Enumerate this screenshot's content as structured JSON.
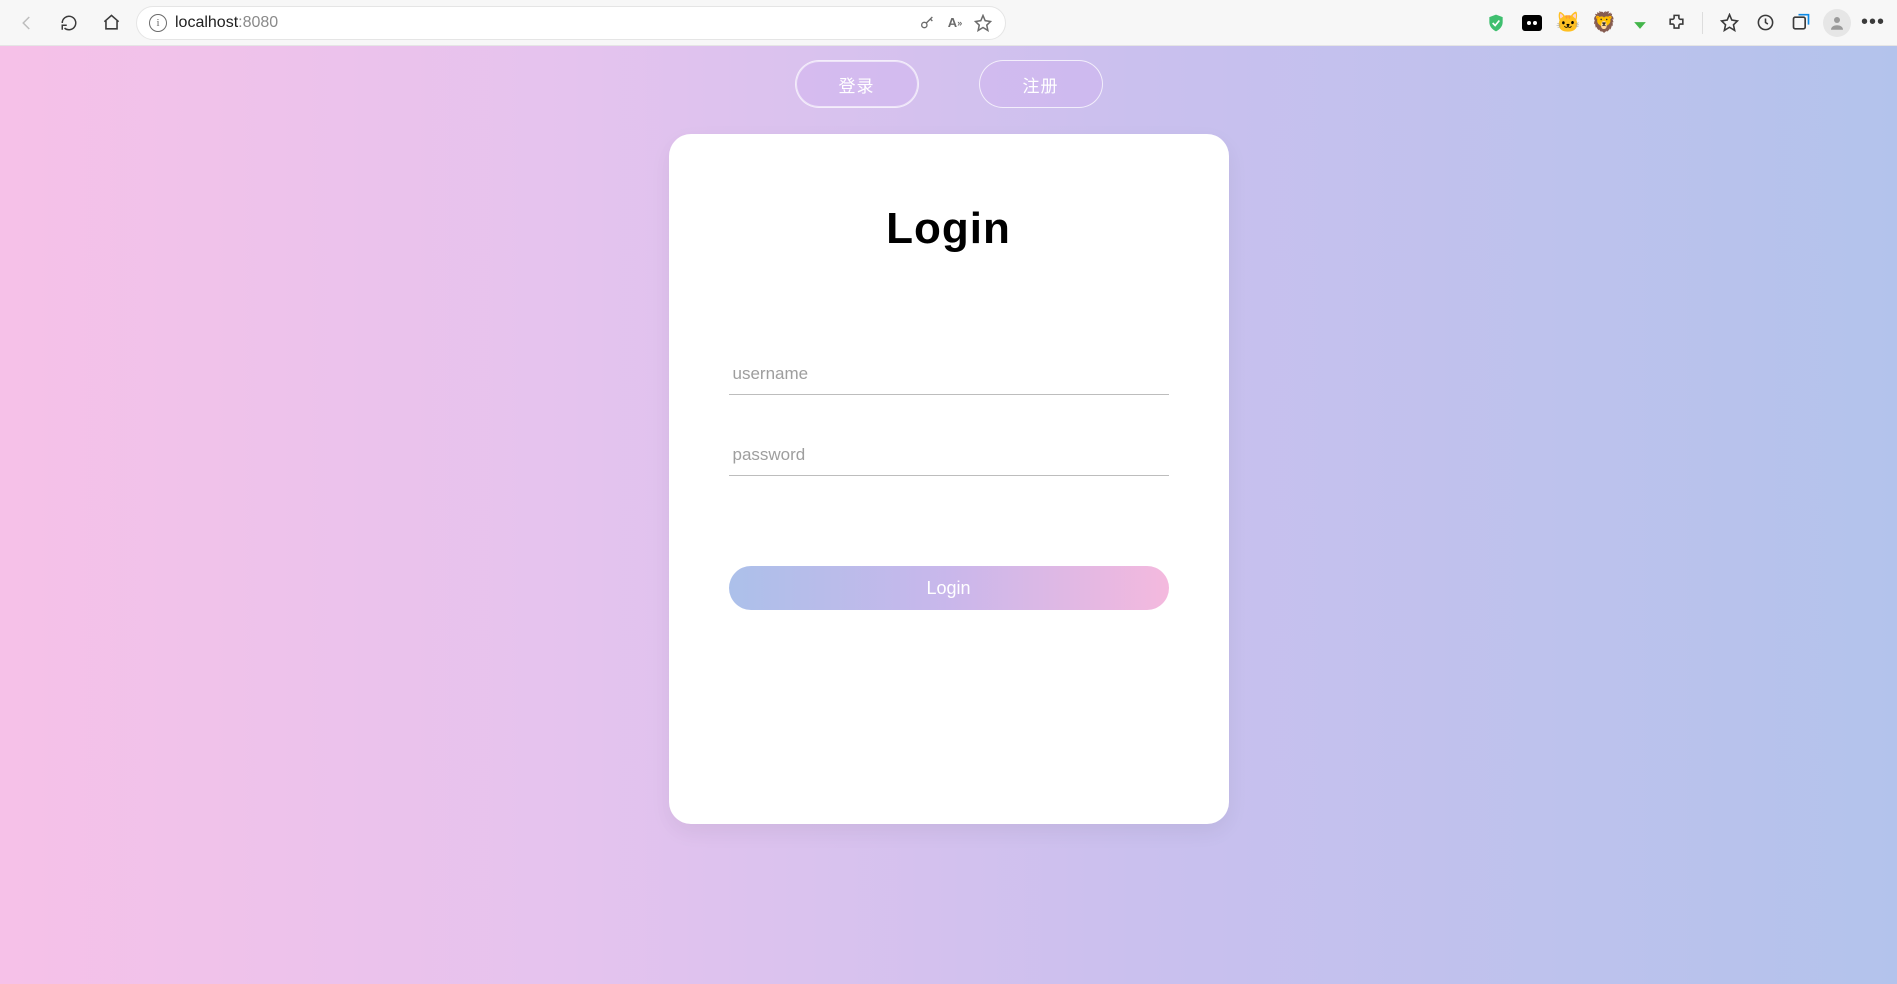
{
  "browser": {
    "url_host": "localhost",
    "url_port": ":8080"
  },
  "tabs": {
    "login": "登录",
    "register": "注册"
  },
  "card": {
    "title": "Login",
    "username_placeholder": "username",
    "password_placeholder": "password",
    "submit": "Login"
  }
}
